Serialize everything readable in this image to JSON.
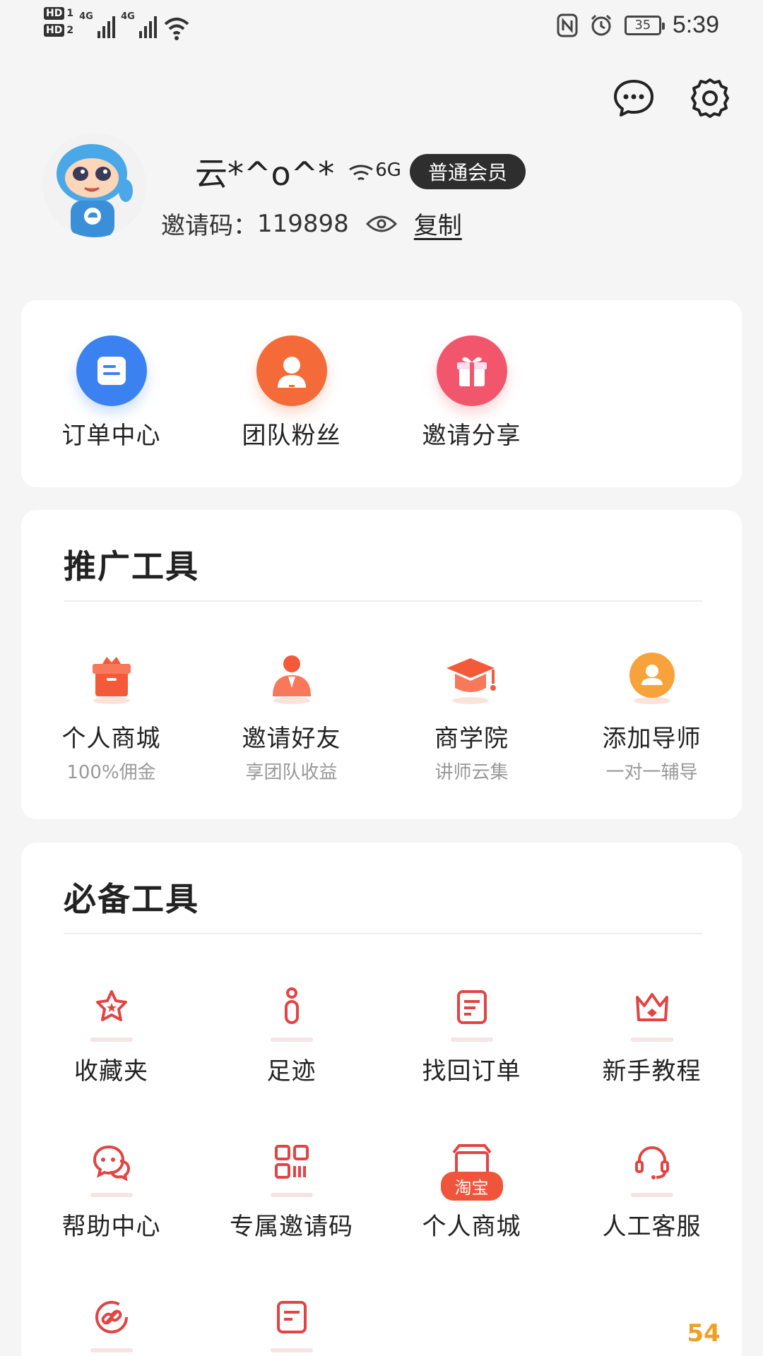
{
  "status_bar": {
    "sim1_tag": "HD",
    "sim1_num": "1",
    "sim2_tag": "HD",
    "sim2_num": "2",
    "net1": "4G",
    "net2": "4G",
    "battery": "35",
    "time": "5:39"
  },
  "header": {
    "message_icon": "chat-bubble-icon",
    "settings_icon": "gear-icon"
  },
  "profile": {
    "name": "云*^o^*",
    "name_suffix": "6G",
    "badge": "普通会员",
    "invite_label": "邀请码：",
    "invite_code": "119898",
    "copy_label": "复制"
  },
  "quick_actions": [
    {
      "label": "订单中心",
      "icon": "order-doc-icon",
      "color": "#3b82f0"
    },
    {
      "label": "团队粉丝",
      "icon": "person-icon",
      "color": "#f46a38"
    },
    {
      "label": "邀请分享",
      "icon": "gift-icon",
      "color": "#f2566c"
    }
  ],
  "promo_tools": {
    "title": "推广工具",
    "items": [
      {
        "label": "个人商城",
        "sub": "100%佣金",
        "icon": "gift-box-icon"
      },
      {
        "label": "邀请好友",
        "sub": "享团队收益",
        "icon": "user-tie-icon"
      },
      {
        "label": "商学院",
        "sub": "讲师云集",
        "icon": "graduation-cap-icon"
      },
      {
        "label": "添加导师",
        "sub": "一对一辅导",
        "icon": "mentor-icon"
      }
    ]
  },
  "essential_tools": {
    "title": "必备工具",
    "items": [
      {
        "label": "收藏夹",
        "icon": "star-icon"
      },
      {
        "label": "足迹",
        "icon": "footprint-icon"
      },
      {
        "label": "找回订单",
        "icon": "order-icon"
      },
      {
        "label": "新手教程",
        "icon": "crown-icon"
      },
      {
        "label": "帮助中心",
        "icon": "chat-help-icon"
      },
      {
        "label": "专属邀请码",
        "icon": "qr-code-icon"
      },
      {
        "label": "个人商城",
        "icon": "shop-icon",
        "tag": "淘宝"
      },
      {
        "label": "人工客服",
        "icon": "headset-icon"
      },
      {
        "label": "",
        "icon": "link-icon"
      },
      {
        "label": "",
        "icon": "note-icon"
      }
    ]
  },
  "watermark": "54"
}
